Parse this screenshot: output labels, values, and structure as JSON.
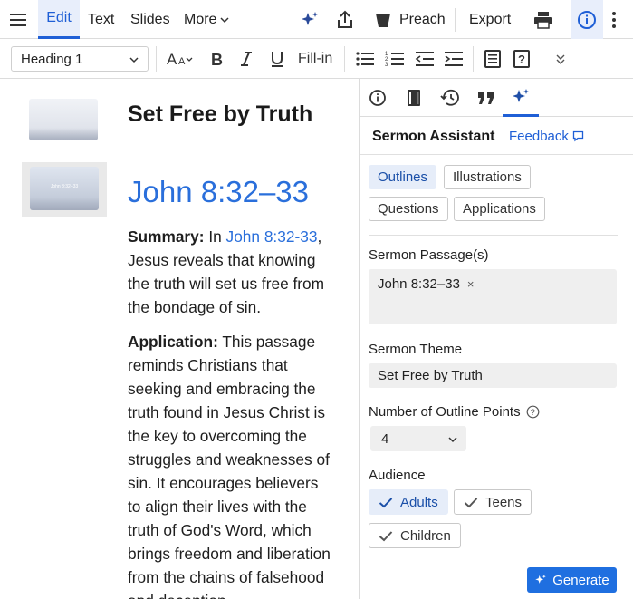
{
  "toolbar": {
    "tabs": [
      {
        "label": "Edit",
        "active": true
      },
      {
        "label": "Text"
      },
      {
        "label": "Slides"
      },
      {
        "label": "More"
      }
    ],
    "preach_label": "Preach",
    "export_label": "Export",
    "icons": [
      "hamburger-menu-icon",
      "sparkle-icon",
      "share-icon",
      "preach-podium-icon",
      "print-icon",
      "info-icon",
      "kebab-menu-icon"
    ]
  },
  "format_bar": {
    "style_value": "Heading 1",
    "fill_in_label": "Fill-in",
    "icons": [
      "font-size-icon",
      "bold-icon",
      "italic-icon",
      "underline-icon",
      "bullet-list-icon",
      "numbered-list-icon",
      "outdent-icon",
      "indent-icon",
      "notes-icon",
      "question-icon",
      "collapse-chevrons-icon"
    ]
  },
  "document": {
    "title": "Set Free by Truth",
    "slide_thumb_text": "John 8:32–33",
    "heading": "John 8:32–33",
    "summary_label": "Summary:",
    "summary_pre": " In ",
    "summary_ref": "John 8:32-33",
    "summary_post": ", Jesus reveals that knowing the truth will set us free from the bondage of sin.",
    "application_label": "Application:",
    "application_text": " This passage reminds Christians that seeking and embracing the truth found in Jesus Christ is the key to overcoming the struggles and weaknesses of sin. It encourages believers to align their lives with the truth of God's Word, which brings freedom and liberation from the chains of falsehood and deception."
  },
  "panel": {
    "tab_icons": [
      "info-icon",
      "book-icon",
      "history-icon",
      "quote-icon",
      "sparkle-icon"
    ],
    "title": "Sermon Assistant",
    "feedback_label": "Feedback",
    "chips": [
      "Outlines",
      "Illustrations",
      "Questions",
      "Applications"
    ],
    "selected_chip": "Outlines",
    "passage_label": "Sermon Passage(s)",
    "passage_tag": "John 8:32–33",
    "passage_remove": "×",
    "theme_label": "Sermon Theme",
    "theme_value": "Set Free by Truth",
    "points_label": "Number of Outline Points",
    "points_value": "4",
    "audience_label": "Audience",
    "audience": [
      {
        "label": "Adults",
        "selected": true
      },
      {
        "label": "Teens",
        "selected": false
      },
      {
        "label": "Children",
        "selected": false
      }
    ],
    "generate_label": "Generate"
  },
  "colors": {
    "accent": "#1f5fd6",
    "link": "#2a6fdb",
    "primary_button": "#1f6fe0",
    "selected_chip_bg": "#e6edf9"
  }
}
